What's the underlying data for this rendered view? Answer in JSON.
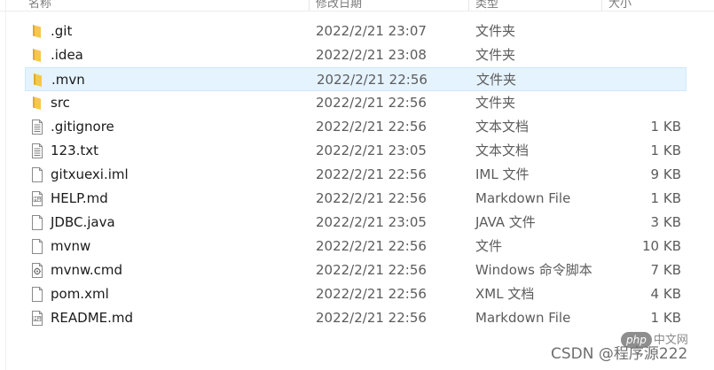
{
  "header": {
    "col_name": "名称",
    "col_date": "修改日期",
    "col_type": "类型",
    "col_size": "大小"
  },
  "files": [
    {
      "name": ".git",
      "date": "2022/2/21 23:07",
      "type": "文件夹",
      "size": "",
      "icon": "folder-icon",
      "selected": false
    },
    {
      "name": ".idea",
      "date": "2022/2/21 23:08",
      "type": "文件夹",
      "size": "",
      "icon": "folder-icon",
      "selected": false
    },
    {
      "name": ".mvn",
      "date": "2022/2/21 22:56",
      "type": "文件夹",
      "size": "",
      "icon": "folder-icon",
      "selected": true
    },
    {
      "name": "src",
      "date": "2022/2/21 22:56",
      "type": "文件夹",
      "size": "",
      "icon": "folder-icon",
      "selected": false
    },
    {
      "name": ".gitignore",
      "date": "2022/2/21 22:56",
      "type": "文本文档",
      "size": "1 KB",
      "icon": "text-document-icon",
      "selected": false
    },
    {
      "name": "123.txt",
      "date": "2022/2/21 23:05",
      "type": "文本文档",
      "size": "1 KB",
      "icon": "text-document-icon",
      "selected": false
    },
    {
      "name": "gitxuexi.iml",
      "date": "2022/2/21 22:56",
      "type": "IML 文件",
      "size": "9 KB",
      "icon": "blank-file-icon",
      "selected": false
    },
    {
      "name": "HELP.md",
      "date": "2022/2/21 22:56",
      "type": "Markdown File",
      "size": "1 KB",
      "icon": "markdown-file-icon",
      "selected": false
    },
    {
      "name": "JDBC.java",
      "date": "2022/2/21 23:05",
      "type": "JAVA 文件",
      "size": "3 KB",
      "icon": "blank-file-icon",
      "selected": false
    },
    {
      "name": "mvnw",
      "date": "2022/2/21 22:56",
      "type": "文件",
      "size": "10 KB",
      "icon": "blank-file-icon",
      "selected": false
    },
    {
      "name": "mvnw.cmd",
      "date": "2022/2/21 22:56",
      "type": "Windows 命令脚本",
      "size": "7 KB",
      "icon": "cmd-script-icon",
      "selected": false
    },
    {
      "name": "pom.xml",
      "date": "2022/2/21 22:56",
      "type": "XML 文档",
      "size": "4 KB",
      "icon": "blank-file-icon",
      "selected": false
    },
    {
      "name": "README.md",
      "date": "2022/2/21 22:56",
      "type": "Markdown File",
      "size": "1 KB",
      "icon": "markdown-file-icon",
      "selected": false
    }
  ],
  "watermark": {
    "logo_badge": "php",
    "logo_text": "中文网",
    "text": "CSDN @程序源222"
  },
  "colors": {
    "selection_bg": "#e5f3ff",
    "selection_border": "#cce8ff",
    "folder": "#f0c34c"
  }
}
